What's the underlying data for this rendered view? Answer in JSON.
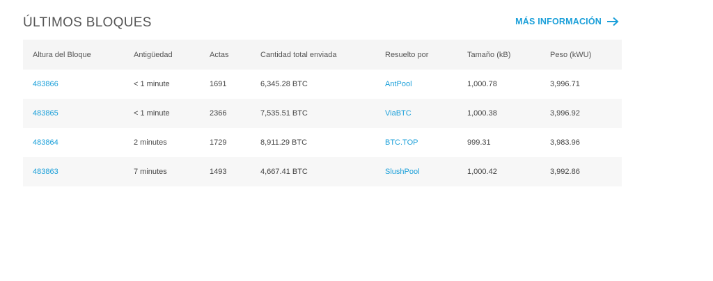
{
  "section": {
    "title": "ÚLTIMOS BLOQUES",
    "more_link": "MÁS INFORMACIÓN",
    "accent_color": "#1a9fd9"
  },
  "table": {
    "headers": [
      "Altura del Bloque",
      "Antigüedad",
      "Actas",
      "Cantidad total enviada",
      "Resuelto por",
      "Tamaño (kB)",
      "Peso (kWU)"
    ],
    "rows": [
      {
        "height": "483866",
        "age": "< 1 minute",
        "txs": "1691",
        "sent": "6,345.28 BTC",
        "relayed_by": "AntPool",
        "size": "1,000.78",
        "weight": "3,996.71"
      },
      {
        "height": "483865",
        "age": "< 1 minute",
        "txs": "2366",
        "sent": "7,535.51 BTC",
        "relayed_by": "ViaBTC",
        "size": "1,000.38",
        "weight": "3,996.92"
      },
      {
        "height": "483864",
        "age": "2 minutes",
        "txs": "1729",
        "sent": "8,911.29 BTC",
        "relayed_by": "BTC.TOP",
        "size": "999.31",
        "weight": "3,983.96"
      },
      {
        "height": "483863",
        "age": "7 minutes",
        "txs": "1493",
        "sent": "4,667.41 BTC",
        "relayed_by": "SlushPool",
        "size": "1,000.42",
        "weight": "3,992.86"
      }
    ]
  }
}
